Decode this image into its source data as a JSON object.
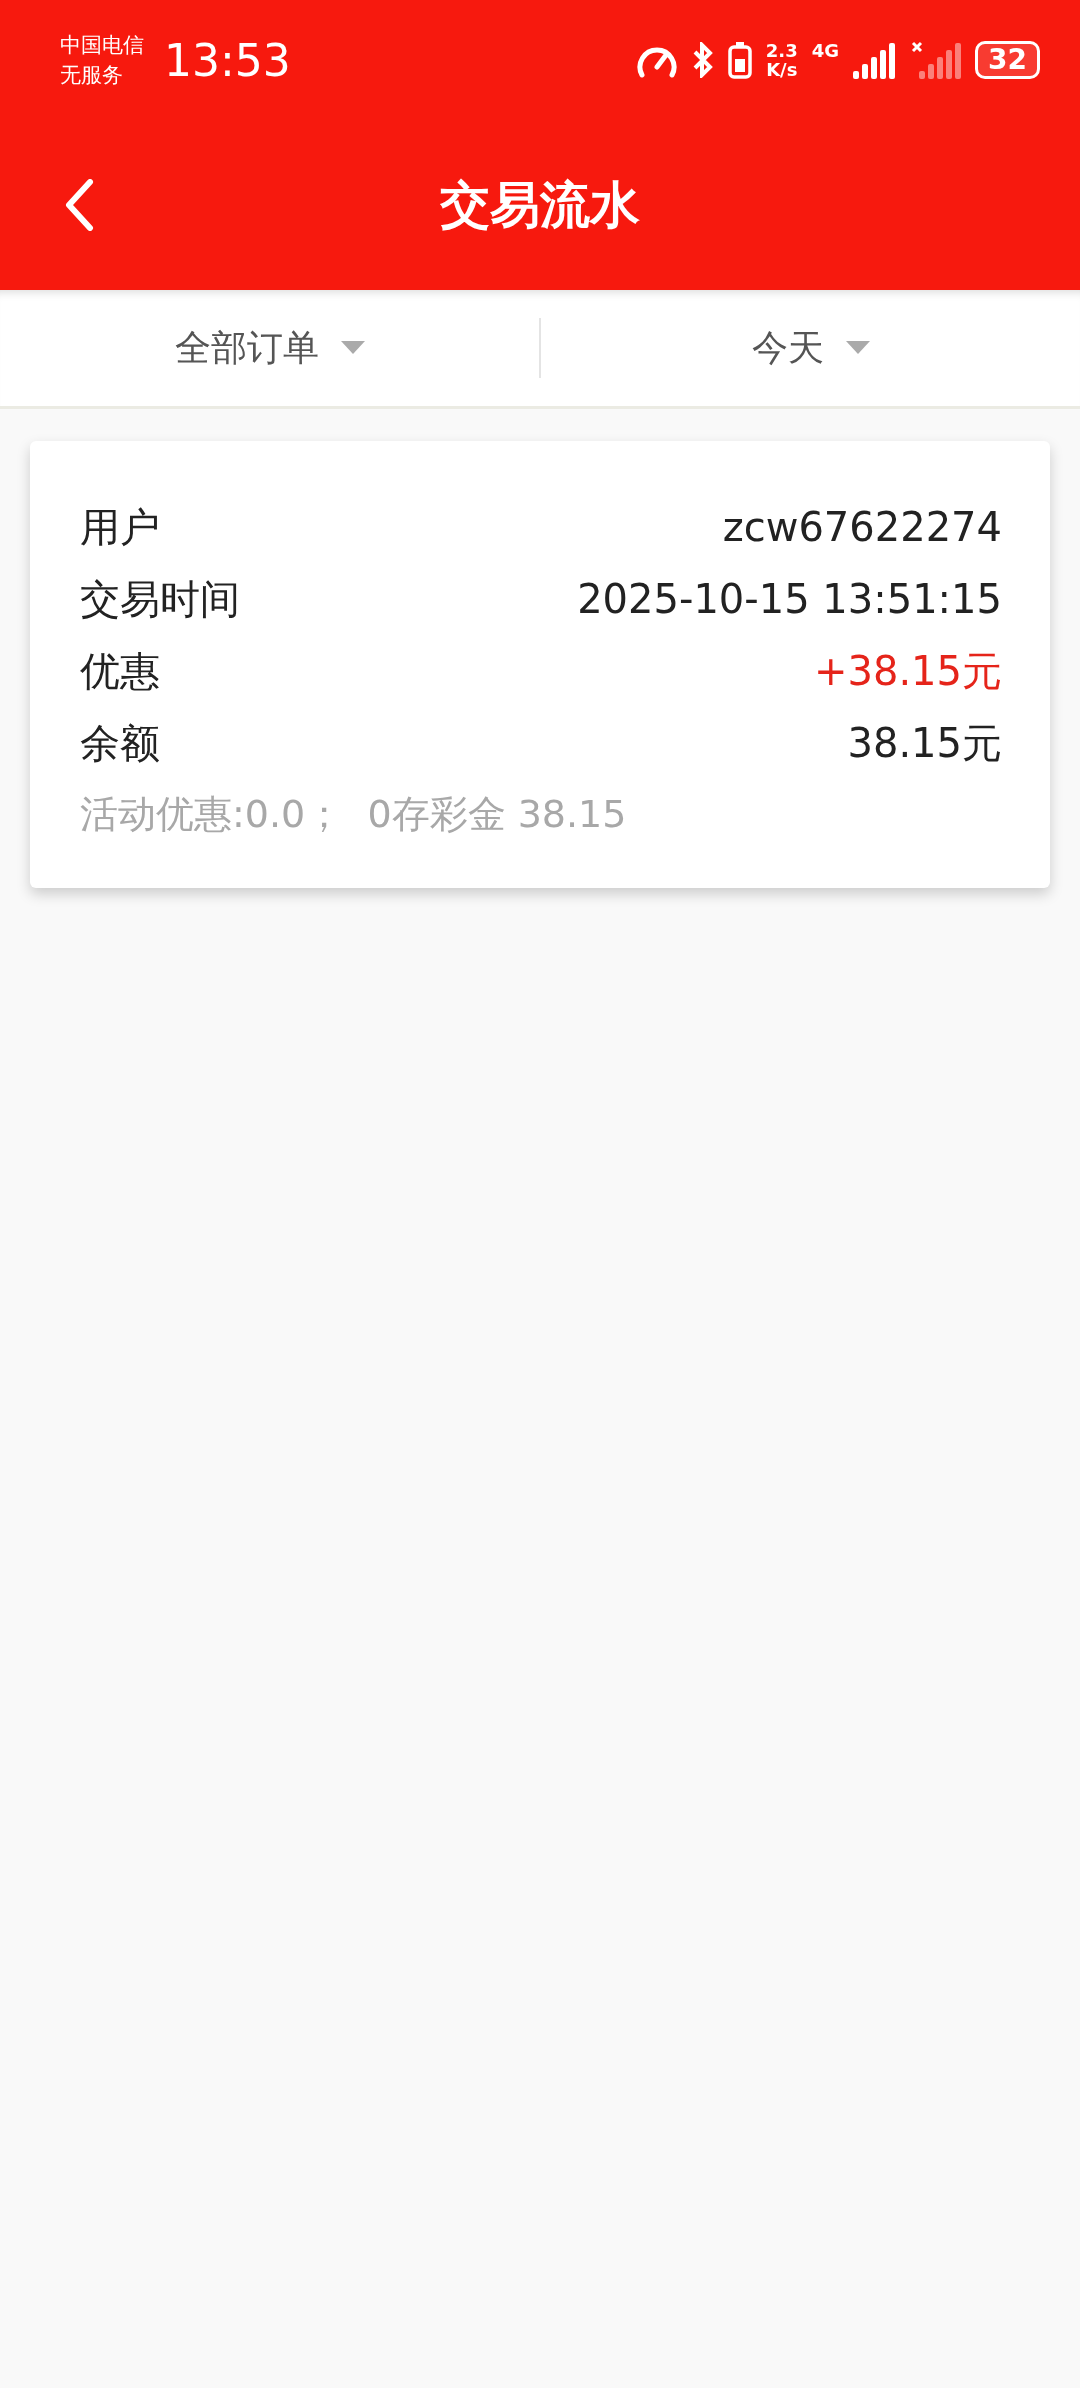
{
  "status_bar": {
    "carrier": "中国电信",
    "service": "无服务",
    "time": "13:53",
    "speed_value": "2.3",
    "speed_unit": "K/s",
    "network": "4G",
    "battery": "32"
  },
  "header": {
    "title": "交易流水"
  },
  "filters": [
    {
      "label": "全部订单"
    },
    {
      "label": "今天"
    }
  ],
  "records": [
    {
      "rows": [
        {
          "label": "用户",
          "value": "zcw67622274",
          "color": "#222222"
        },
        {
          "label": "交易时间",
          "value": "2025-10-15 13:51:15",
          "color": "#222222"
        },
        {
          "label": "优惠",
          "value": "+38.15元",
          "color": "#e5241a"
        },
        {
          "label": "余额",
          "value": "38.15元",
          "color": "#222222"
        }
      ],
      "note": "活动优惠:0.0；  0存彩金 38.15"
    }
  ]
}
